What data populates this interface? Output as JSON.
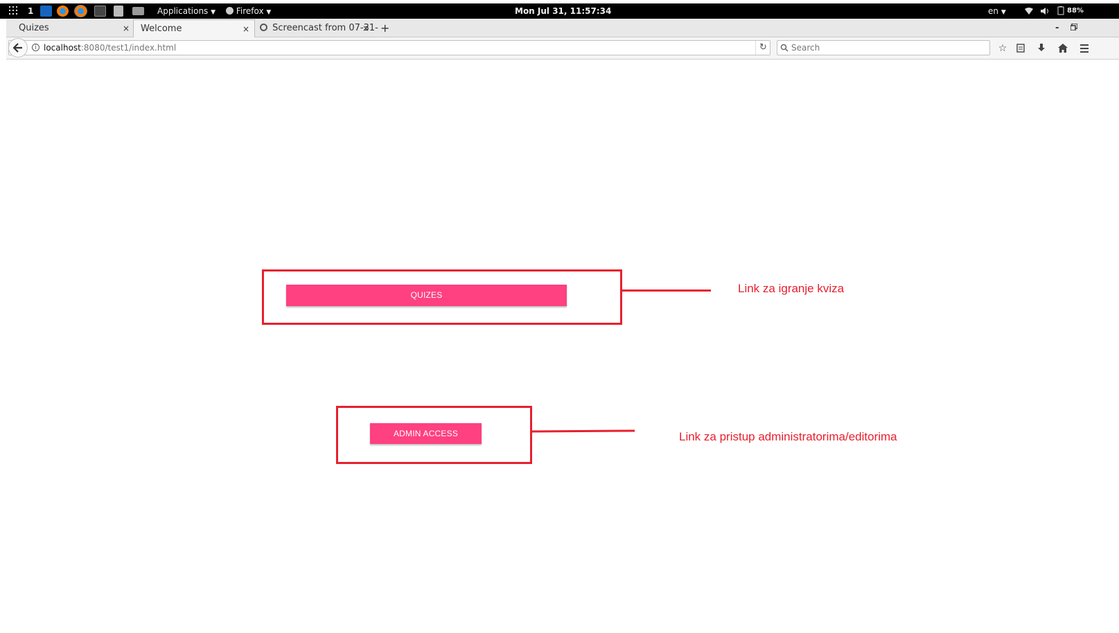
{
  "top_panel": {
    "workspace": "1",
    "applications_label": "Applications",
    "firefox_label": "Firefox",
    "clock": "Mon Jul 31, 11:57:34",
    "language": "en",
    "battery": "88%"
  },
  "tabs": [
    {
      "label": "Quizes",
      "close": "×"
    },
    {
      "label": "Welcome",
      "close": "×"
    },
    {
      "label": "Screencast from 07-31-",
      "close": "×"
    }
  ],
  "new_tab": "+",
  "window_controls": {
    "minimize": "-",
    "restore": "🗗"
  },
  "url": {
    "host": "localhost",
    "path": ":8080/test1/index.html"
  },
  "search": {
    "placeholder": "Search"
  },
  "page": {
    "quizes_button": "QUIZES",
    "admin_button": "ADMIN ACCESS"
  },
  "annotations": {
    "quizes_note": "Link za igranje kviza",
    "admin_note": "Link za pristup administratorima/editorima"
  },
  "colors": {
    "accent": "#ff4081",
    "annotation": "#e8202e"
  }
}
